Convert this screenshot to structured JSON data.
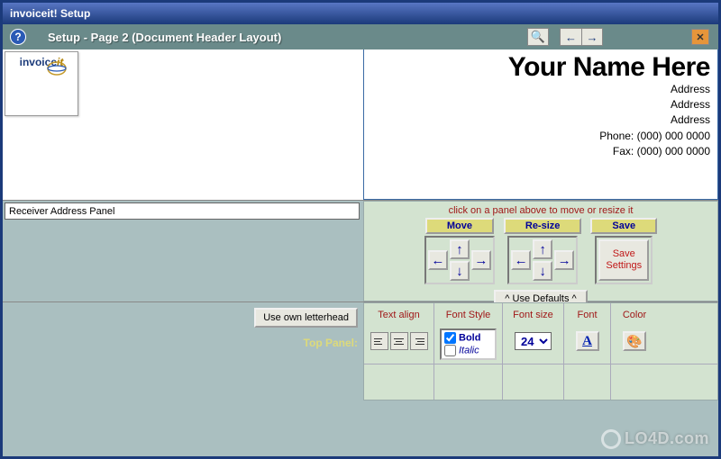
{
  "window": {
    "title": "invoiceit! Setup"
  },
  "toolbar": {
    "title": "Setup - Page 2 (Document Header Layout)",
    "help_glyph": "?",
    "search_glyph": "🔍",
    "prev_glyph": "←",
    "next_glyph": "→",
    "close_glyph": "✕"
  },
  "logo": {
    "text_a": "invoice",
    "text_b": "it"
  },
  "header": {
    "company": "Your Name Here",
    "lines": [
      "Address",
      "Address",
      "Address",
      "Phone: (000) 000 0000",
      "Fax: (000) 000 0000"
    ]
  },
  "receiver": {
    "label": "Receiver Address Panel"
  },
  "controls": {
    "hint": "click on a panel above to move or resize it",
    "move_label": "Move",
    "resize_label": "Re-size",
    "save_label": "Save",
    "save_button": "Save Settings",
    "use_defaults": "^ Use Defaults ^",
    "arrows": {
      "left": "←",
      "up": "↑",
      "right": "→",
      "down": "↓"
    }
  },
  "bottom": {
    "use_own": "Use own letterhead",
    "top_panel": "Top Panel:"
  },
  "format": {
    "text_align": "Text align",
    "font_style": "Font Style",
    "bold": "Bold",
    "italic": "Italic",
    "font_size": "Font size",
    "size_value": "24",
    "font": "Font",
    "font_glyph": "A",
    "color": "Color",
    "color_glyph": "🎨"
  },
  "watermark": "LO4D.com"
}
